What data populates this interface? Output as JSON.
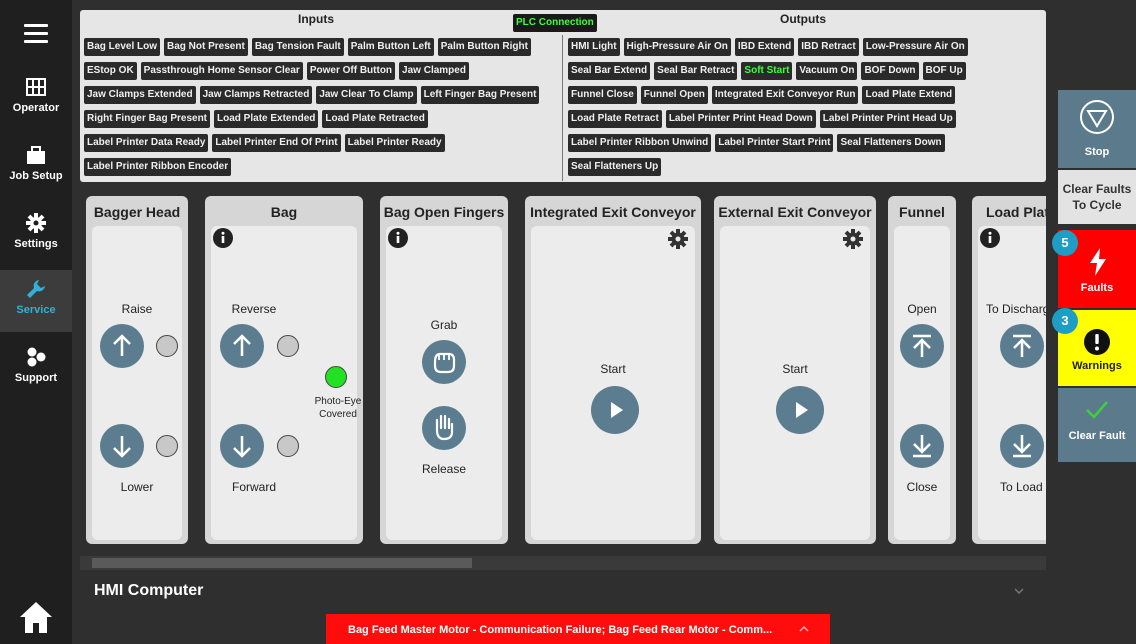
{
  "sidebar": {
    "items": [
      {
        "label": "Operator",
        "icon": "grid-icon"
      },
      {
        "label": "Job Setup",
        "icon": "briefcase-icon"
      },
      {
        "label": "Settings",
        "icon": "gear-icon"
      },
      {
        "label": "Service",
        "icon": "wrench-icon",
        "active": true
      },
      {
        "label": "Support",
        "icon": "hexagons-icon"
      }
    ]
  },
  "io": {
    "inputs_title": "Inputs",
    "outputs_title": "Outputs",
    "plc_label": "PLC Connection",
    "inputs": [
      "Bag Level Low",
      "Bag Not Present",
      "Bag Tension Fault",
      "Palm Button Left",
      "Palm Button Right",
      "EStop OK",
      "Passthrough Home Sensor Clear",
      "Power Off Button",
      "Jaw Clamped",
      "Jaw Clamps Extended",
      "Jaw Clamps Retracted",
      "Jaw Clear To Clamp",
      "Left Finger Bag Present",
      "Right Finger Bag Present",
      "Load Plate Extended",
      "Load Plate Retracted",
      "Label Printer Data Ready",
      "Label Printer End Of Print",
      "Label Printer Ready",
      "Label Printer Ribbon Encoder"
    ],
    "outputs": [
      "HMI Light",
      "High-Pressure Air On",
      "IBD Extend",
      "IBD Retract",
      "Low-Pressure Air On",
      "Seal Bar Extend",
      "Seal Bar Retract",
      "Soft Start",
      "Vacuum On",
      "BOF Down",
      "BOF Up",
      "Funnel Close",
      "Funnel Open",
      "Integrated Exit Conveyor Run",
      "Load Plate Extend",
      "Load Plate Retract",
      "Label Printer Print Head Down",
      "Label Printer Print Head Up",
      "Label Printer Ribbon Unwind",
      "Label Printer Start Print",
      "Seal Flatteners Down",
      "Seal Flatteners Up"
    ],
    "active_outputs": [
      "Soft Start"
    ]
  },
  "cards": {
    "bagger_head": {
      "title": "Bagger Head",
      "top_label": "Raise",
      "bottom_label": "Lower"
    },
    "bag": {
      "title": "Bag",
      "top_label": "Reverse",
      "bottom_label": "Forward",
      "sensor_label_1": "Photo-Eye",
      "sensor_label_2": "Covered"
    },
    "bag_open_fingers": {
      "title": "Bag Open Fingers",
      "top_label": "Grab",
      "bottom_label": "Release"
    },
    "integrated_exit": {
      "title": "Integrated Exit Conveyor",
      "action_label": "Start"
    },
    "external_exit": {
      "title": "External Exit Conveyor",
      "action_label": "Start"
    },
    "funnel": {
      "title": "Funnel",
      "top_label": "Open",
      "bottom_label": "Close"
    },
    "load_plate": {
      "title": "Load Plate",
      "top_label": "To Discharge",
      "bottom_label": "To Load"
    }
  },
  "hmi": {
    "title": "HMI Computer"
  },
  "alert": {
    "text": "Bag Feed Master Motor - Communication Failure; Bag Feed Rear Motor - Comm..."
  },
  "right_panel": {
    "stop_label": "Stop",
    "clear_cycle_label_1": "Clear Faults",
    "clear_cycle_label_2": "To Cycle",
    "faults_label": "Faults",
    "faults_count": "5",
    "warnings_label": "Warnings",
    "warnings_count": "3",
    "clear_fault_label": "Clear Fault"
  },
  "colors": {
    "accent": "#2fb2d6",
    "button": "#5c7d90",
    "fault": "#ff0000",
    "warning": "#ffff00",
    "ok": "#22e022"
  }
}
